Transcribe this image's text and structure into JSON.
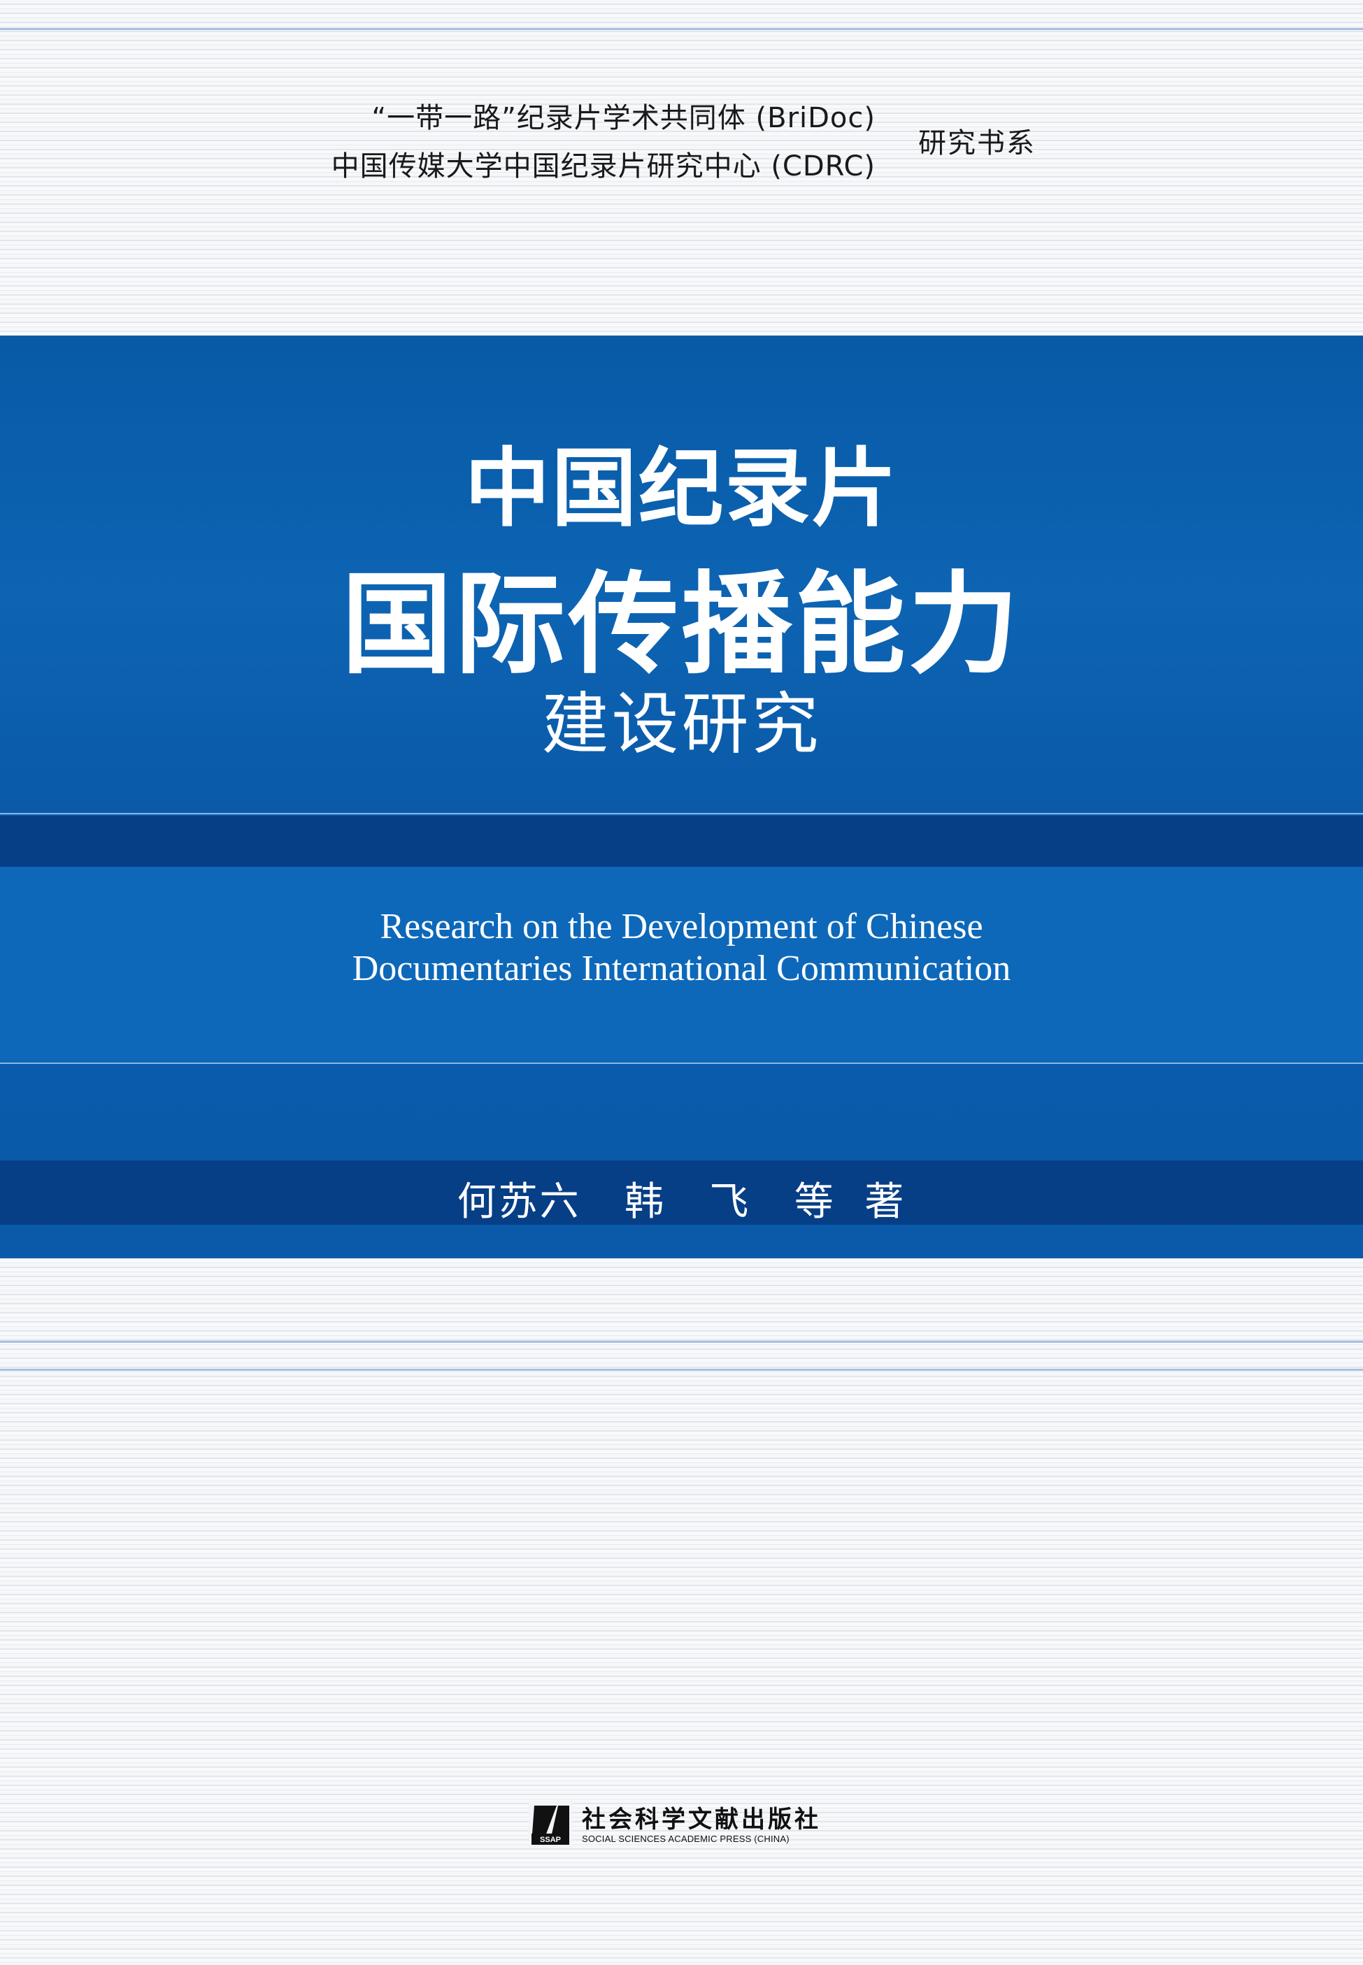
{
  "series": {
    "line1": "“一带一路”纪录片学术共同体 (BriDoc)",
    "line2": "中国传媒大学中国纪录片研究中心 (CDRC)",
    "suffix": "研究书系"
  },
  "title": {
    "line1": "中国纪录片",
    "line2": "国际传播能力",
    "line3": "建设研究"
  },
  "english_title": {
    "line1": "Research on the Development of Chinese",
    "line2": "Documentaries International Communication"
  },
  "authors": "何苏六   韩   飞   等  著",
  "publisher": {
    "name_cn": "社会科学文献出版社",
    "name_en": "SOCIAL SCIENCES ACADEMIC PRESS (CHINA)",
    "logo_text": "SSAP"
  },
  "colors": {
    "band_blue": "#0b5cae",
    "dark_blue": "#073f86",
    "accent_line": "#7aa3d6"
  }
}
